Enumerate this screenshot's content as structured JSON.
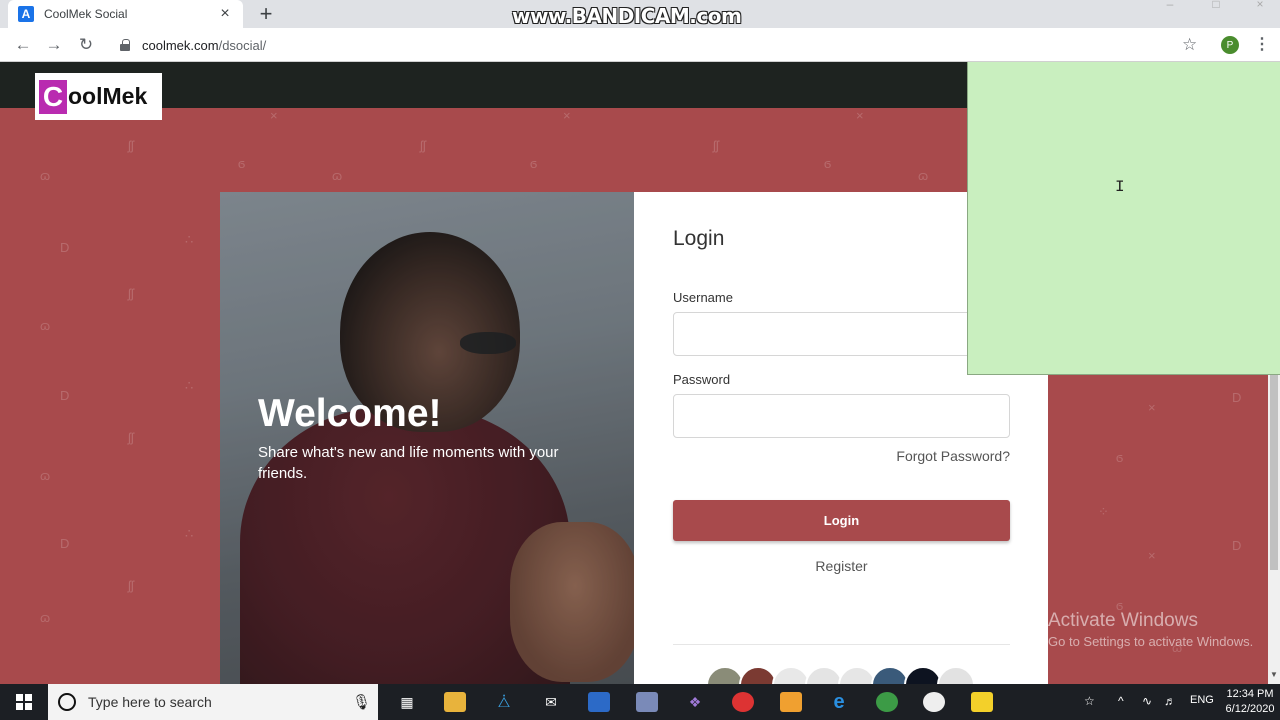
{
  "browser": {
    "tab_title": "CoolMek Social",
    "tab_favicon": "A",
    "new_tab_glyph": "+",
    "close_glyph": "×",
    "watermark": "www.BANDICAM.com",
    "url_host": "coolmek.com",
    "url_path": "/dsocial/",
    "profile_initial": "P"
  },
  "site": {
    "logo_initial": "C",
    "logo_text": "oolMek"
  },
  "hero": {
    "title": "Welcome!",
    "subtitle": "Share what's new and life moments with your friends."
  },
  "login": {
    "title": "Login",
    "username_label": "Username",
    "username_value": "",
    "password_label": "Password",
    "password_value": "",
    "forgot_label": "Forgot Password?",
    "submit_label": "Login",
    "register_label": "Register",
    "avatar_colors": [
      "#8a8c78",
      "#7b3a32",
      "#e8e8e8",
      "#e4e4e4",
      "#e6e6e6",
      "#3a5a7a",
      "#0d1320",
      "#e2e2e2"
    ]
  },
  "overlay": {
    "sticky_note_color": "#c9efbf"
  },
  "windows": {
    "activate_title": "Activate Windows",
    "activate_sub": "Go to Settings to activate Windows.",
    "search_placeholder": "Type here to search",
    "lang": "ENG",
    "time": "12:34 PM",
    "date": "6/12/2020"
  },
  "colors": {
    "brand": "#a84a4c",
    "header": "#1e2320",
    "logo_accent": "#b92bb0"
  }
}
